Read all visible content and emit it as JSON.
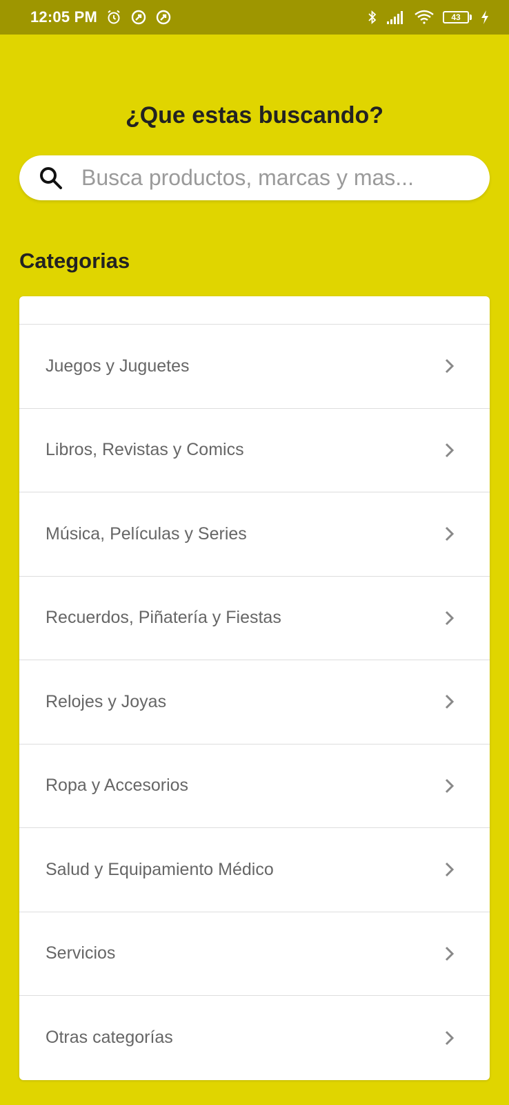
{
  "status_bar": {
    "time": "12:05 PM",
    "battery_level": "43",
    "icons": [
      "alarm-icon",
      "data-saver-icon",
      "data-saver-icon",
      "bluetooth-icon",
      "signal-icon",
      "wifi-icon",
      "battery-icon",
      "charging-icon"
    ]
  },
  "header": {
    "title": "¿Que estas buscando?"
  },
  "search": {
    "placeholder": "Busca productos, marcas y mas...",
    "value": "",
    "icon": "search-icon"
  },
  "categories": {
    "title": "Categorias",
    "items": [
      {
        "label": "Juegos y Juguetes"
      },
      {
        "label": "Libros, Revistas y Comics"
      },
      {
        "label": "Música, Películas y Series"
      },
      {
        "label": "Recuerdos, Piñatería y Fiestas"
      },
      {
        "label": "Relojes y Joyas"
      },
      {
        "label": "Ropa y Accesorios"
      },
      {
        "label": "Salud y Equipamiento Médico"
      },
      {
        "label": "Servicios"
      },
      {
        "label": "Otras categorías"
      }
    ]
  },
  "colors": {
    "background": "#E0D500",
    "status_bar": "#9E9600",
    "card": "#FFFFFF",
    "heading_text": "#222222",
    "item_text": "#666666"
  }
}
